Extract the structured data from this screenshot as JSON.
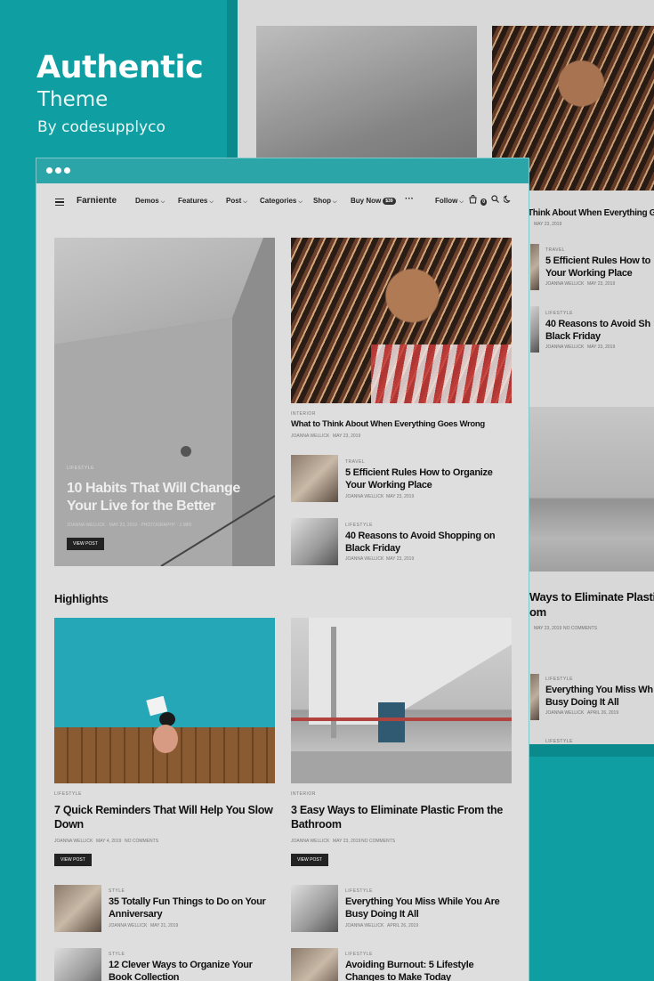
{
  "promo": {
    "title": "Authentic",
    "subtitle": "Theme",
    "byline": "By codesupplyco"
  },
  "site": {
    "logo": "Farniente",
    "nav": [
      {
        "label": "Demos"
      },
      {
        "label": "Features"
      },
      {
        "label": "Post"
      },
      {
        "label": "Categories"
      },
      {
        "label": "Shop"
      }
    ],
    "buy_now": "Buy Now",
    "buy_badge": "$39",
    "more": "···",
    "follow": "Follow",
    "cart_count": "0"
  },
  "hero": {
    "category": "LIFESTYLE",
    "title_line1": "10 Habits That Will Change",
    "title_line2": "Your Live for the Better",
    "meta": "JOANNA WELLICK · MAY 23, 2019 · PHOTOGRAPHY · 1 MIN",
    "button": "VIEW POST"
  },
  "featured": {
    "category": "INTERIOR",
    "title": "What to Think About When Everything Goes Wrong",
    "author": "JOANNA WELLICK",
    "date": "MAY 23, 2019"
  },
  "side_posts": [
    {
      "category": "TRAVEL",
      "title_line1": "5 Efficient Rules How to Organize",
      "title_line2": "Your Working Place",
      "author": "JOANNA WELLICK",
      "date": "MAY 23, 2019"
    },
    {
      "category": "LIFESTYLE",
      "title_line1": "40 Reasons to Avoid Shopping on",
      "title_line2": "Black Friday",
      "author": "JOANNA WELLICK",
      "date": "MAY 23, 2019"
    }
  ],
  "highlights": {
    "heading": "Highlights",
    "left": {
      "category": "LIFESTYLE",
      "title_line1": "7 Quick Reminders That Will Help You Slow",
      "title_line2": "Down",
      "author": "JOANNA WELLICK",
      "date": "MAY 4, 2019",
      "comments": "NO COMMENTS",
      "button": "VIEW POST"
    },
    "right": {
      "category": "INTERIOR",
      "title_line1": "3 Easy Ways to Eliminate Plastic From the",
      "title_line2": "Bathroom",
      "author": "JOANNA WELLICK",
      "date": "MAY 23, 2019",
      "comments": "NO COMMENTS",
      "button": "VIEW POST"
    }
  },
  "list_posts": [
    {
      "category": "STYLE",
      "title_line1": "35 Totally Fun Things to Do on Your",
      "title_line2": "Anniversary",
      "author": "JOANNA WELLICK",
      "date": "MAY 21, 2019"
    },
    {
      "category": "LIFESTYLE",
      "title_line1": "Everything You Miss While You Are",
      "title_line2": "Busy Doing It All",
      "author": "JOANNA WELLICK",
      "date": "APRIL 26, 2019"
    },
    {
      "category": "STYLE",
      "title_line1": "12 Clever Ways to Organize Your",
      "title_line2": "Book Collection"
    },
    {
      "category": "LIFESTYLE",
      "title_line1": "Avoiding Burnout: 5 Lifestyle",
      "title_line2": "Changes to Make Today"
    }
  ],
  "back_window": {
    "featured_title": "Think About When Everything Goes",
    "featured_date": "MAY 23, 2019",
    "post1_cat": "TRAVEL",
    "post1_l1": "5 Efficient Rules How to",
    "post1_l2": "Your Working Place",
    "post1_author": "JOANNA WELLICK",
    "post1_date": "MAY 23, 2019",
    "post2_cat": "LIFESTYLE",
    "post2_l1": "40 Reasons to Avoid Sh",
    "post2_l2": "Black Friday",
    "post2_author": "JOANNA WELLICK",
    "post2_date": "MAY 23, 2019",
    "hl_l1": "Ways to Eliminate Plastic",
    "hl_l2": "om",
    "hl_date": "MAY 23, 2019",
    "hl_comments": "NO COMMENTS",
    "post3_cat": "LIFESTYLE",
    "post3_l1": "Everything You Miss Wh",
    "post3_l2": "Busy Doing It All",
    "post3_author": "JOANNA WELLICK",
    "post3_date": "APRIL 26, 2019",
    "post4_cat": "LIFESTYLE"
  },
  "colors": {
    "background": "#0f9ea1",
    "window_bar": "#2ba5a8"
  }
}
